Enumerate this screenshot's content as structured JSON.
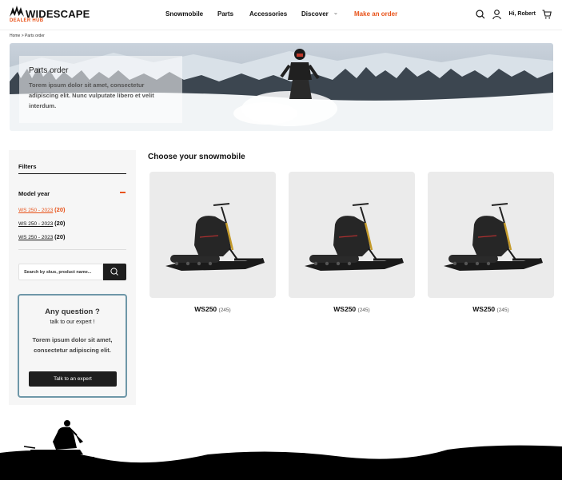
{
  "header": {
    "brand_name": "WIDESCAPE",
    "brand_sub": "DEALER HUB",
    "nav": [
      "Snowmobile",
      "Parts",
      "Accessories",
      "Discover"
    ],
    "make_order": "Make an order",
    "greeting": "Hi, Robert",
    "icons": [
      "search-icon",
      "user-icon",
      "cart-icon"
    ]
  },
  "breadcrumb": "Home > Parts order",
  "hero": {
    "title": "Parts order",
    "text": "Torem ipsum dolor sit amet, consectetur adipiscing elit. Nunc vulputate libero et velit interdum."
  },
  "filters": {
    "title": "Filters",
    "group_title": "Model year",
    "options": [
      {
        "label": "WS 250 - 2023",
        "count": "(20)",
        "active": true
      },
      {
        "label": "WS 250 - 2023",
        "count": "(20)",
        "active": false
      },
      {
        "label": "WS 250 - 2023",
        "count": "(20)",
        "active": false
      }
    ],
    "search_placeholder": "Search by skus, product name..."
  },
  "expert": {
    "question": "Any question ?",
    "sub": "talk to our expert !",
    "text": "Torem ipsum dolor sit amet, consectetur adipiscing elit.",
    "button": "Talk to an expert"
  },
  "main": {
    "title": "Choose your snowmobile",
    "products": [
      {
        "name": "WS250",
        "count": "(245)"
      },
      {
        "name": "WS250",
        "count": "(245)"
      },
      {
        "name": "WS250",
        "count": "(245)"
      }
    ]
  },
  "colors": {
    "accent": "#e8531a",
    "dark": "#1e1e1e",
    "card_border": "#6e97a8"
  }
}
